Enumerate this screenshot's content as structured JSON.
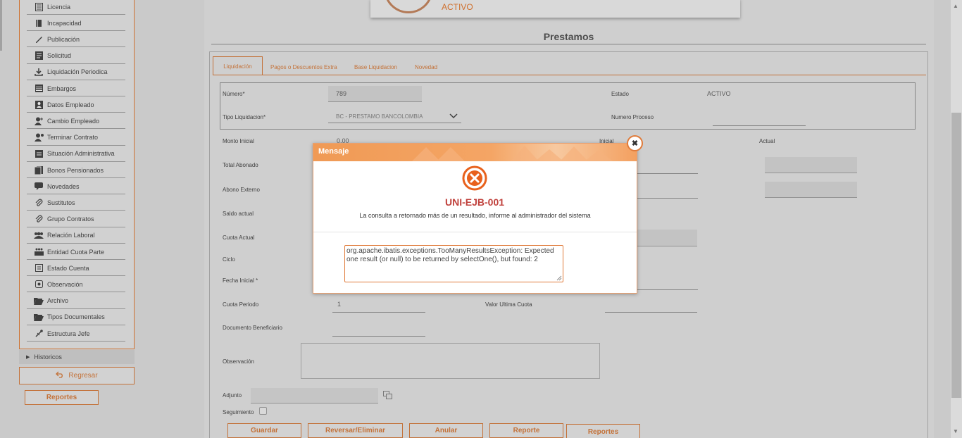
{
  "sidebar": {
    "items": [
      {
        "label": "Licencia",
        "icon": "document-list-icon"
      },
      {
        "label": "Incapacidad",
        "icon": "book-icon"
      },
      {
        "label": "Publicación",
        "icon": "pencil-icon"
      },
      {
        "label": "Solicitud",
        "icon": "form-icon"
      },
      {
        "label": "Liquidación Periodica",
        "icon": "download-icon"
      },
      {
        "label": "Embargos",
        "icon": "table-icon"
      },
      {
        "label": "Datos Empleado",
        "icon": "person-card-icon"
      },
      {
        "label": "Cambio Empleado",
        "icon": "user-change-icon"
      },
      {
        "label": "Terminar Contrato",
        "icon": "user-remove-icon"
      },
      {
        "label": "Situación Administrativa",
        "icon": "clipboard-icon"
      },
      {
        "label": "Bonos Pensionados",
        "icon": "bonds-icon"
      },
      {
        "label": "Novedades",
        "icon": "speech-bubble-icon"
      },
      {
        "label": "Sustitutos",
        "icon": "paperclip-icon"
      },
      {
        "label": "Grupo Contratos",
        "icon": "paperclip-icon"
      },
      {
        "label": "Relación Laboral",
        "icon": "users-group-icon"
      },
      {
        "label": "Entidad Cuota Parte",
        "icon": "building-people-icon"
      },
      {
        "label": "Estado Cuenta",
        "icon": "account-icon"
      },
      {
        "label": "Observación",
        "icon": "observation-icon"
      },
      {
        "label": "Archivo",
        "icon": "folder-open-icon"
      },
      {
        "label": "Tipos Documentales",
        "icon": "folder-open-icon"
      },
      {
        "label": "Estructura Jefe",
        "icon": "hierarchy-icon"
      }
    ],
    "historicos_label": "Historicos",
    "regresar_label": "Regresar",
    "reportes_label": "Reportes"
  },
  "header": {
    "status": "ACTIVO",
    "title": "Prestamos"
  },
  "tabs": [
    "Liquidación",
    "Pagos o Descuentos Extra",
    "Base Liquidacion",
    "Novedad"
  ],
  "form": {
    "numero_label": "Número*",
    "numero_value": "789",
    "estado_label": "Estado",
    "estado_value": "ACTIVO",
    "tipo_label": "Tipo Liquidacion*",
    "tipo_value": "BC - PRESTAMO BANCOLOMBIA",
    "numero_proceso_label": "Numero Proceso",
    "monto_inicial_label": "Monto Inicial",
    "monto_inicial_value": "0.00",
    "inicial_label": "Inicial",
    "actual_label": "Actual",
    "total_abonado_label": "Total Abonado",
    "abono_externo_label": "Abono Externo",
    "saldo_actual_label": "Saldo actual",
    "cuota_actual_label": "Cuota Actual",
    "ciclo_label": "Ciclo",
    "fecha_inicial_label": "Fecha Inicial *",
    "cuota_periodo_label": "Cuota Periodo",
    "cuota_periodo_value": "1",
    "valor_ultima_cuota_label": "Valor Ultima Cuota",
    "documento_beneficiario_label": "Documento Beneficiario",
    "observacion_label": "Observación",
    "adjunto_label": "Adjunto",
    "seguimiento_label": "Seguimiento"
  },
  "buttons": {
    "guardar": "Guardar",
    "reversar": "Reversar/Eliminar",
    "anular": "Anular",
    "reporte": "Reporte",
    "reportes": "Reportes"
  },
  "modal": {
    "title": "Mensaje",
    "code": "UNI-EJB-001",
    "message": "La consulta a retornado más de un resultado, informe al administrador del sistema",
    "detail": "org.apache.ibatis.exceptions.TooManyResultsException: Expected one result (or null) to be returned by selectOne(), but found: 2"
  },
  "colors": {
    "accent": "#d4702a",
    "error": "#c0413c",
    "modal_header": "#f09a55"
  }
}
